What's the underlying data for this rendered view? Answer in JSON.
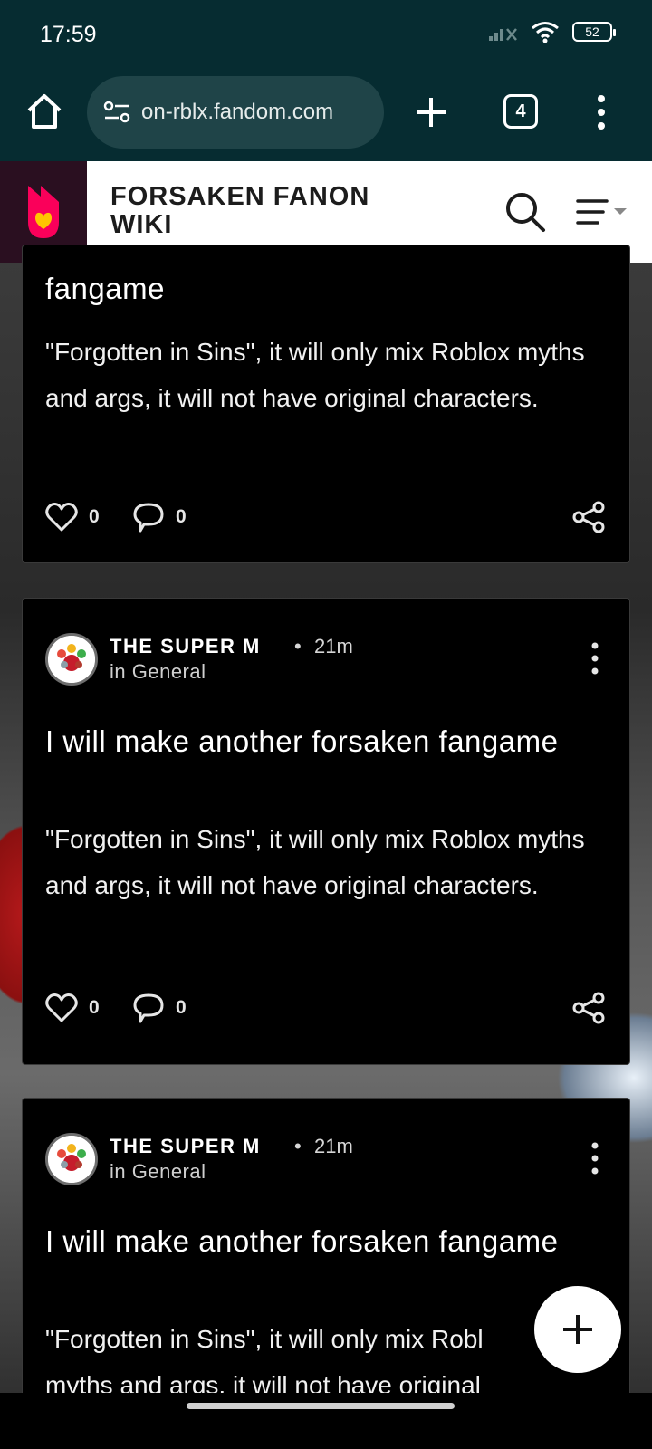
{
  "status_bar": {
    "time": "17:59",
    "battery": "52"
  },
  "browser": {
    "url": "on-rblx.fandom.com",
    "tab_count": "4"
  },
  "wiki": {
    "title": "FORSAKEN FANON WIKI"
  },
  "posts": [
    {
      "title_tail": "fangame",
      "excerpt": "\"Forgotten in Sins\", it will only mix Roblox myths and args, it will not have original characters.",
      "likes": "0",
      "comments": "0"
    },
    {
      "author": "THE SUPER M",
      "separator": "•",
      "time": "21m",
      "category": "in General",
      "title": "I will make another forsaken fangame",
      "excerpt": "\"Forgotten in Sins\", it will only mix Roblox myths and args, it will not have original characters.",
      "likes": "0",
      "comments": "0"
    },
    {
      "author": "THE SUPER M",
      "separator": "•",
      "time": "21m",
      "category": "in General",
      "title": "I will make another forsaken fangame",
      "excerpt": "\"Forgotten in Sins\", it will only mix Robl myths and args, it will not have original"
    }
  ],
  "colors": {
    "browser_chrome": "#062c31",
    "url_pill": "#1f4448",
    "fandom_logo": "#fa005a",
    "card_bg": "#000000"
  },
  "icons": [
    "home-icon",
    "site-settings-icon",
    "plus-icon",
    "more-vertical-icon",
    "fandom-logo",
    "search-icon",
    "menu-icon",
    "heart-icon",
    "comment-icon",
    "share-icon"
  ]
}
